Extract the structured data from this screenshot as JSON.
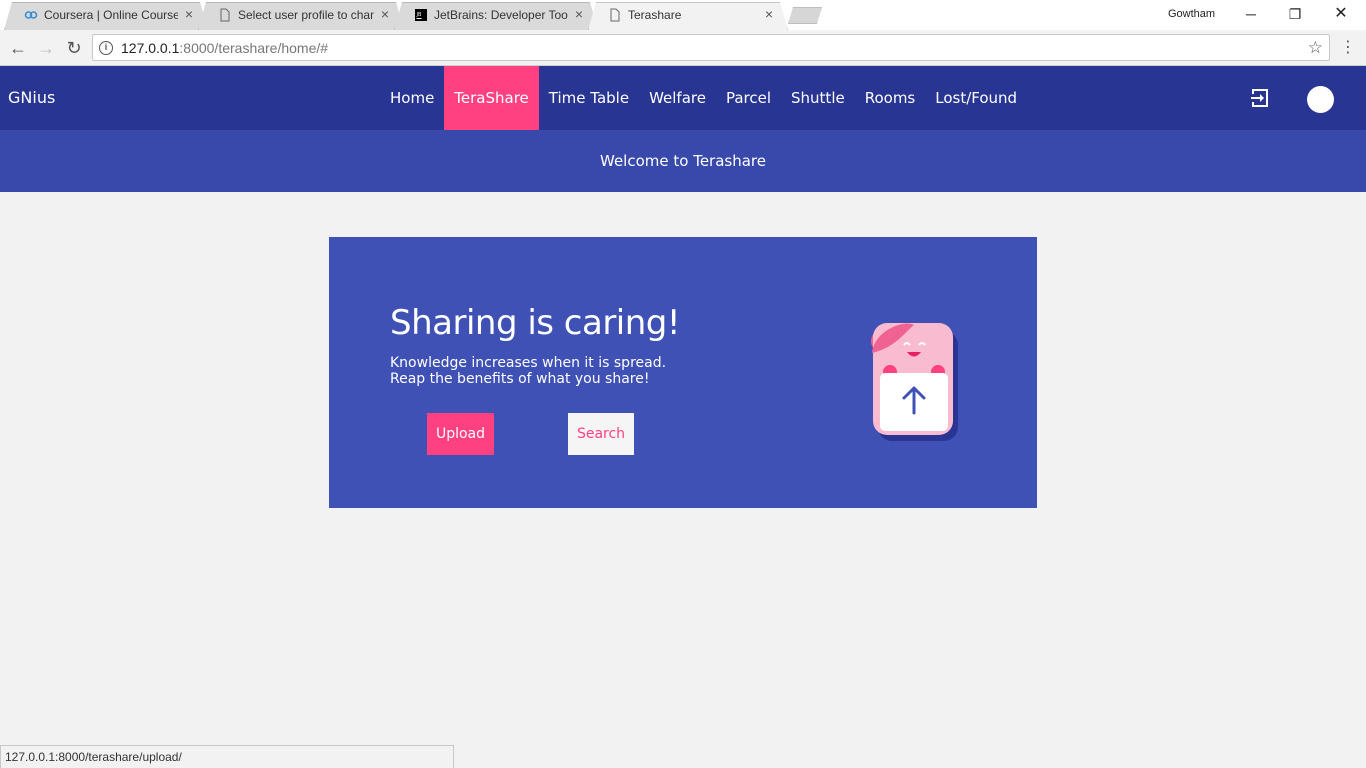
{
  "browser": {
    "tabs": [
      {
        "title": "Coursera | Online Courses",
        "icon": "coursera-icon"
      },
      {
        "title": "Select user profile to change",
        "icon": "page-icon"
      },
      {
        "title": "JetBrains: Developer Tools",
        "icon": "jetbrains-icon"
      },
      {
        "title": "Terashare",
        "icon": "page-icon",
        "active": true
      }
    ],
    "profile_name": "Gowtham",
    "url_host": "127.0.0.1",
    "url_rest": ":8000/terashare/home/#",
    "status_url": "127.0.0.1:8000/terashare/upload/"
  },
  "app": {
    "brand": "GNius",
    "nav": [
      {
        "label": "Home"
      },
      {
        "label": "TeraShare",
        "active": true
      },
      {
        "label": "Time Table"
      },
      {
        "label": "Welfare"
      },
      {
        "label": "Parcel"
      },
      {
        "label": "Shuttle"
      },
      {
        "label": "Rooms"
      },
      {
        "label": "Lost/Found"
      }
    ],
    "welcome": "Welcome to Terashare"
  },
  "hero": {
    "title": "Sharing is caring!",
    "line1": "Knowledge increases when it is spread.",
    "line2": "Reap the benefits of what you share!",
    "upload_label": "Upload",
    "search_label": "Search"
  },
  "colors": {
    "appbar": "#283593",
    "subbar": "#3949ab",
    "hero": "#3f51b5",
    "accent": "#ff4081"
  }
}
